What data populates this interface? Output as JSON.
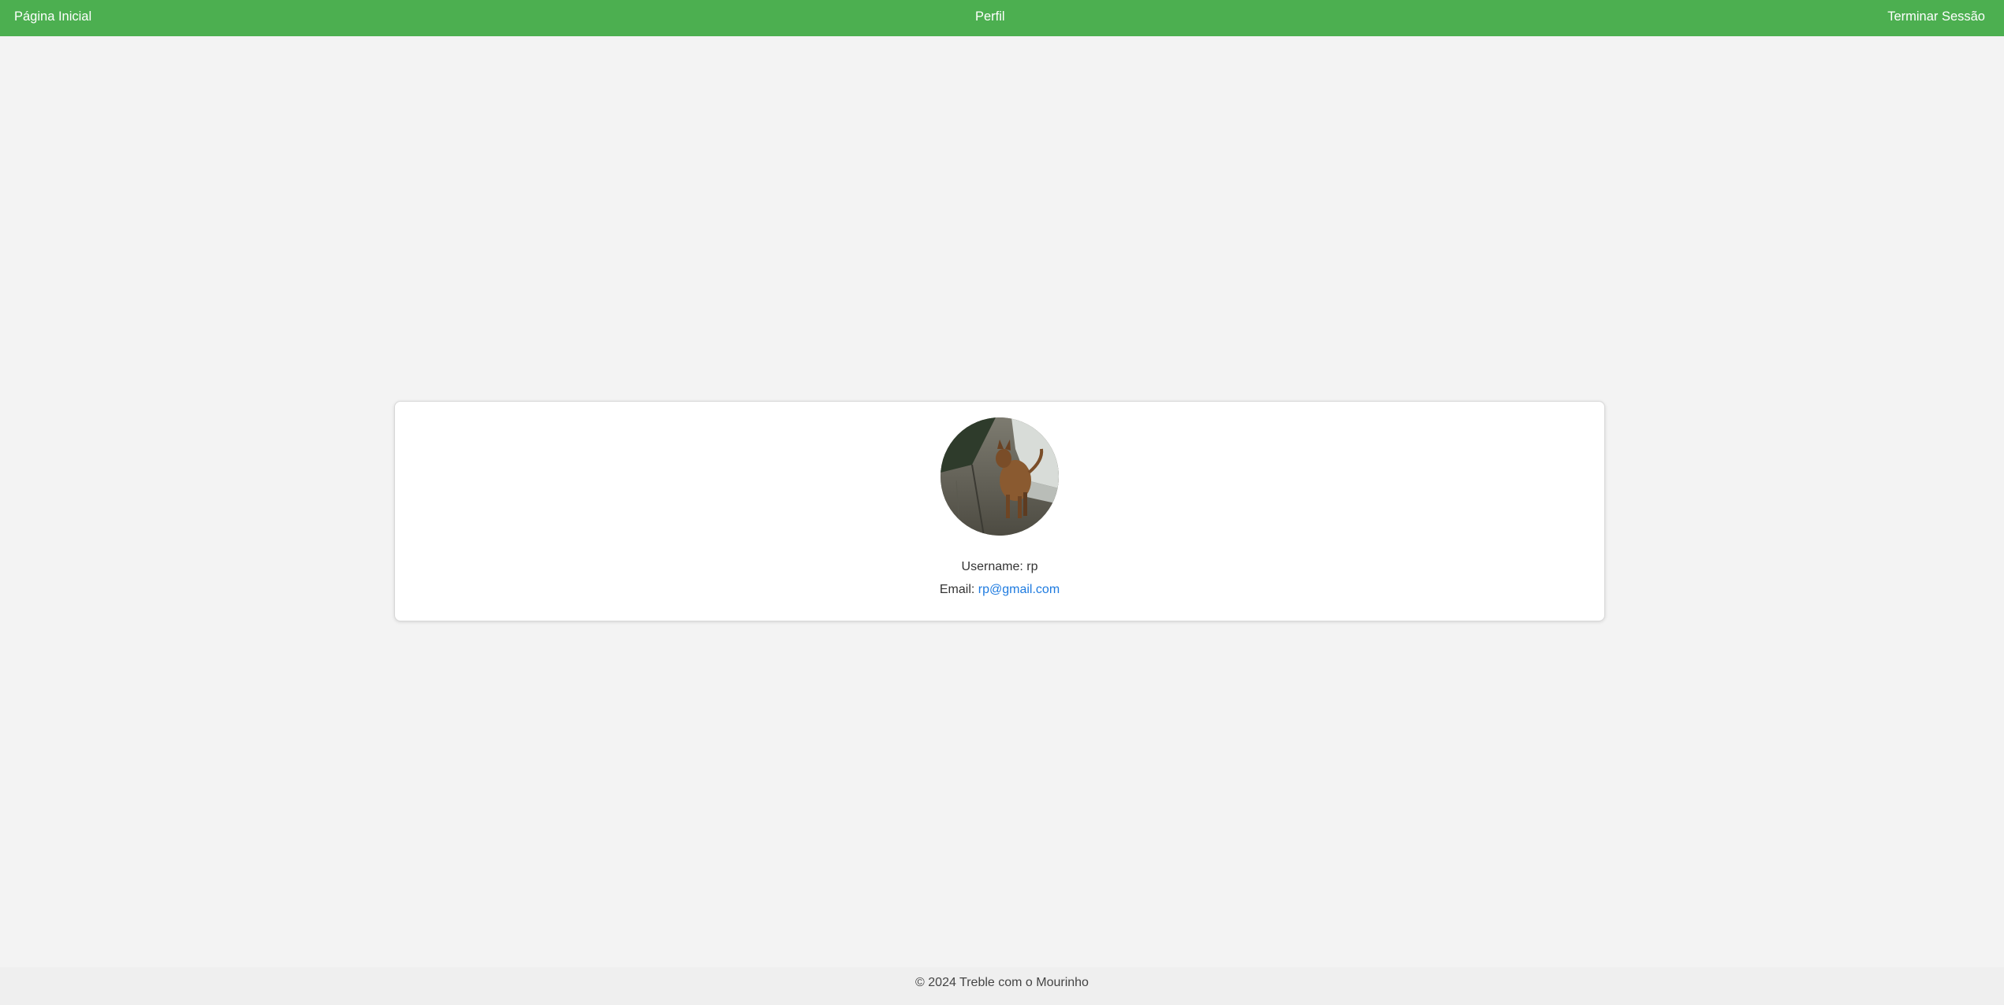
{
  "nav": {
    "home_label": "Página Inicial",
    "profile_label": "Perfil",
    "logout_label": "Terminar Sessão"
  },
  "profile": {
    "avatar_icon": "profile-photo-dog",
    "username_label": "Username:",
    "username_value": "rp",
    "email_label": "Email:",
    "email_value": "rp@gmail.com"
  },
  "footer": {
    "text": "© 2024 Treble com o Mourinho"
  },
  "colors": {
    "navbar": "#4caf50",
    "background": "#f3f3f3",
    "link": "#1e7be0"
  }
}
